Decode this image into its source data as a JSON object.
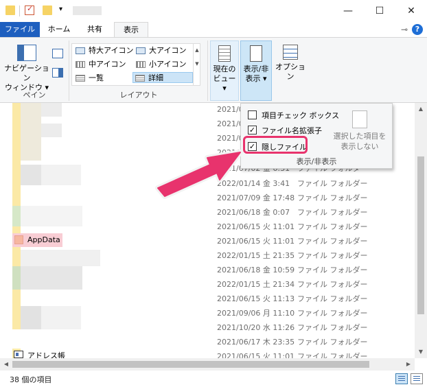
{
  "window": {
    "minimize_glyph": "—",
    "maximize_glyph": "☐",
    "close_glyph": "✕"
  },
  "tabs": [
    {
      "label": "ファイル"
    },
    {
      "label": "ホーム"
    },
    {
      "label": "共有"
    },
    {
      "label": "表示"
    }
  ],
  "help_glyph": "?",
  "ribbon": {
    "pane_group": {
      "nav_pane_line1": "ナビゲーション",
      "nav_pane_line2": "ウィンドウ ▾",
      "label": "ペイン"
    },
    "layout_group": {
      "items": [
        "特大アイコン",
        "大アイコン",
        "中アイコン",
        "小アイコン",
        "一覧",
        "詳細"
      ],
      "selected": "詳細",
      "label": "レイアウト"
    },
    "current_view": {
      "line1": "現在の",
      "line2": "ビュー ▾"
    },
    "show_hide": {
      "line1": "表示/非",
      "line2": "表示 ▾"
    },
    "options": {
      "label": "オプション"
    }
  },
  "dropdown": {
    "items": [
      {
        "label": "項目チェック ボックス",
        "checked": false
      },
      {
        "label": "ファイル名拡張子",
        "checked": true
      },
      {
        "label": "隠しファイル",
        "checked": true
      }
    ],
    "hide_selected_line1": "選択した項目を",
    "hide_selected_line2": "表示しない",
    "group_label": "表示/非表示",
    "highlight_color": "#e8336d"
  },
  "files": {
    "rows": [
      {
        "date": "2021/0",
        "type": ""
      },
      {
        "date": "2021/0",
        "type": ""
      },
      {
        "date": "2021/0",
        "type": ""
      },
      {
        "date": "2021/0",
        "type": ""
      },
      {
        "date": "2021/07/02 金 6:31",
        "type": "ファイル フォルダー"
      },
      {
        "date": "2022/01/14 金 3:41",
        "type": "ファイル フォルダー"
      },
      {
        "date": "2021/07/09 金 17:48",
        "type": "ファイル フォルダー"
      },
      {
        "date": "2021/06/18 金 0:07",
        "type": "ファイル フォルダー"
      },
      {
        "date": "2021/06/15 火 11:01",
        "type": "ファイル フォルダー"
      },
      {
        "date": "2021/06/15 火 11:01",
        "type": "ファイル フォルダー"
      },
      {
        "date": "2022/01/15 土 21:35",
        "type": "ファイル フォルダー"
      },
      {
        "date": "2021/06/18 金 10:59",
        "type": "ファイル フォルダー"
      },
      {
        "date": "2022/01/15 土 21:34",
        "type": "ファイル フォルダー"
      },
      {
        "date": "2021/06/15 火 11:13",
        "type": "ファイル フォルダー"
      },
      {
        "date": "2021/09/06 月 11:10",
        "type": "ファイル フォルダー"
      },
      {
        "date": "2021/10/20 水 11:26",
        "type": "ファイル フォルダー"
      },
      {
        "date": "2021/06/17 木 23:35",
        "type": "ファイル フォルダー"
      },
      {
        "date": "2021/06/15 火 11:01",
        "type": "ファイル フォルダー"
      }
    ],
    "appdata_label": "AppData",
    "appdata_highlight": "#f8cdd4",
    "address_label": "アドレス帳"
  },
  "status": {
    "item_count": "38 個の項目"
  },
  "colors": {
    "accent": "#1e5fbf",
    "arrow": "#e8336d"
  }
}
